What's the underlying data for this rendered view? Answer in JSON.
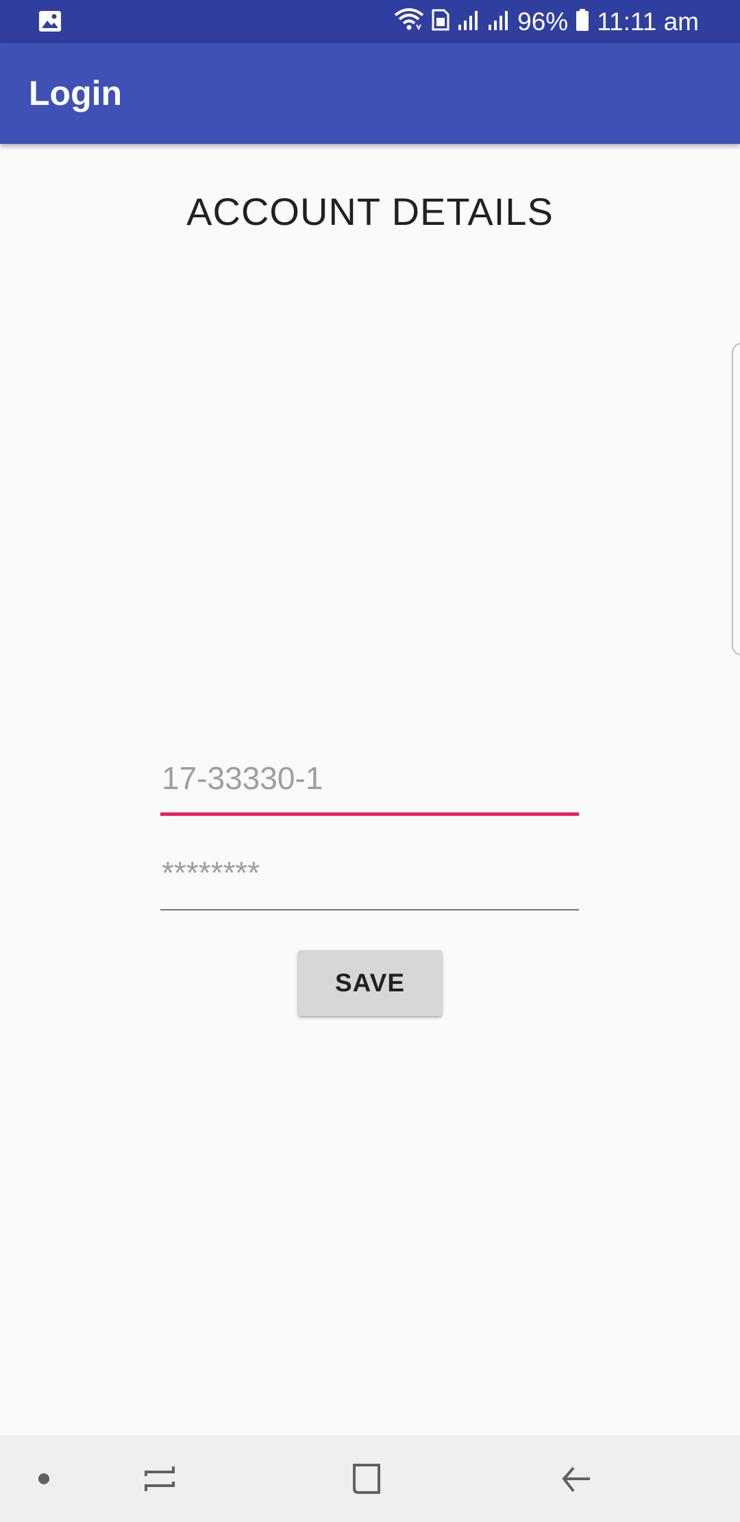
{
  "status_bar": {
    "left_icon": "image-icon",
    "battery_percent": "96%",
    "time": "11:11 am",
    "icons": [
      "wifi-icon",
      "sim-card-icon",
      "signal-icon",
      "signal-icon",
      "battery-icon"
    ],
    "background": "#303F9F"
  },
  "app_bar": {
    "title": "Login",
    "background": "#3F51B5"
  },
  "main": {
    "heading": "ACCOUNT DETAILS",
    "id_field": {
      "value": "",
      "placeholder": "17-33330-1",
      "accent": "#E91E63"
    },
    "password_field": {
      "value": "",
      "placeholder": "********"
    },
    "save_label": "SAVE"
  },
  "nav_bar": {
    "items": [
      "dot-icon",
      "recent-apps-icon",
      "home-icon",
      "back-icon"
    ]
  }
}
